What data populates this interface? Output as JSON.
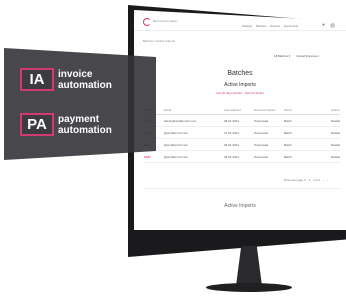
{
  "colors": {
    "accent": "#d23a6c",
    "panel": "#343438",
    "bezel": "#1a1a1d"
  },
  "app": {
    "logo_text": "Bench Automation",
    "nav": [
      "Settings",
      "Batches",
      "Reports",
      "Documents"
    ],
    "breadcrumb": "Batches / Active Imports",
    "subbar_actions": [
      "All Batches ▾",
      "Upload Document"
    ]
  },
  "main": {
    "page_title": "Batches",
    "section_title": "Active Imports",
    "section_subtitle": "Last 30 days batches · Refresh all files",
    "table": {
      "headers": [
        "Batch ID",
        "Email",
        "Last Updated",
        "Document Status",
        "Owner",
        "Actions"
      ],
      "rows": [
        [
          "1348",
          "admin@workbench.com",
          "28.01.2021",
          "Processed",
          "Batch",
          "Details"
        ],
        [
          "1330",
          "@workbench.com",
          "27.01.2021",
          "Processed",
          "Batch",
          "Details"
        ],
        [
          "1341",
          "@workbench.com",
          "26.01.2021",
          "Processed",
          "Batch",
          "Details"
        ],
        [
          "1337",
          "@workbench.com",
          "25.01.2021",
          "Processed",
          "Batch",
          "Details"
        ]
      ]
    },
    "pagination": [
      "Rows per page: 5",
      "1 - 4 of 4",
      "‹",
      "›"
    ],
    "footer_title": "Active Imports"
  },
  "overlay": {
    "features": [
      {
        "badge": "IA",
        "line1": "invoice",
        "line2": "automation"
      },
      {
        "badge": "PA",
        "line1": "payment",
        "line2": "automation"
      }
    ]
  }
}
